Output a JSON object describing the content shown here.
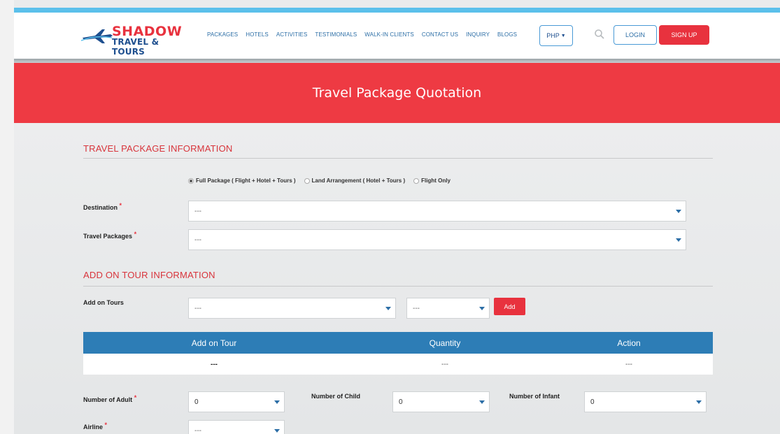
{
  "brand": {
    "line1": "SHADOW",
    "line2": "TRAVEL & TOURS"
  },
  "nav": {
    "items": [
      "PACKAGES",
      "HOTELS",
      "ACTIVITIES",
      "TESTIMONIALS",
      "WALK-IN CLIENTS",
      "CONTACT US",
      "INQUIRY",
      "BLOGS"
    ]
  },
  "header": {
    "currency": "PHP",
    "login": "LOGIN",
    "signup": "SIGN UP"
  },
  "banner": {
    "title": "Travel Package Quotation"
  },
  "package_info": {
    "title": "TRAVEL PACKAGE INFORMATION",
    "options": [
      "Full Package ( Flight + Hotel + Tours )",
      "Land Arrangement ( Hotel + Tours )",
      "Flight Only"
    ],
    "selected_option": 0,
    "destination_label": "Destination",
    "destination_value": "---",
    "packages_label": "Travel Packages",
    "packages_value": "---"
  },
  "addon_info": {
    "title": "ADD ON TOUR INFORMATION",
    "tours_label": "Add on Tours",
    "tour_select_value": "---",
    "qty_select_value": "---",
    "add_button": "Add",
    "table_headers": [
      "Add on Tour",
      "Quantity",
      "Action"
    ],
    "table_rows": [
      [
        "---",
        "---",
        "---"
      ]
    ]
  },
  "travellers": {
    "adult_label": "Number of Adult",
    "adult_value": "0",
    "child_label": "Number of Child",
    "child_value": "0",
    "infant_label": "Number of Infant",
    "infant_value": "0",
    "airline_label": "Airline",
    "airline_value": "---"
  },
  "colors": {
    "accent_red": "#ee3a43",
    "table_blue": "#2d7db6",
    "link_blue": "#2c6ea6"
  }
}
